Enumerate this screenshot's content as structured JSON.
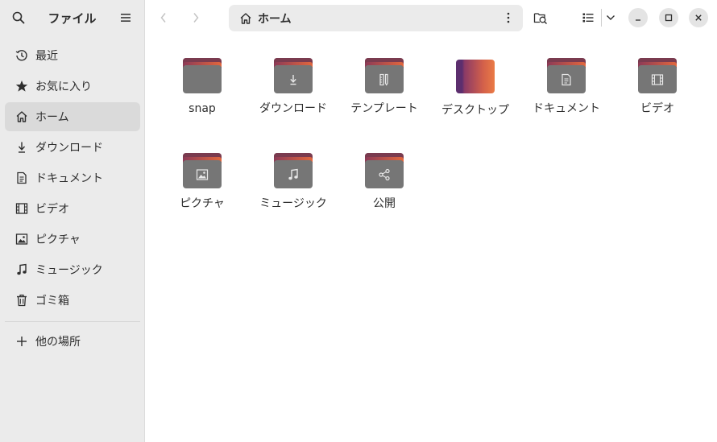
{
  "app": {
    "title": "ファイル"
  },
  "sidebar": {
    "items": [
      {
        "label": "最近",
        "icon": "clock-icon",
        "active": false
      },
      {
        "label": "お気に入り",
        "icon": "star-icon",
        "active": false
      },
      {
        "label": "ホーム",
        "icon": "home-icon",
        "active": true
      },
      {
        "label": "ダウンロード",
        "icon": "download-icon",
        "active": false
      },
      {
        "label": "ドキュメント",
        "icon": "document-icon",
        "active": false
      },
      {
        "label": "ビデオ",
        "icon": "film-icon",
        "active": false
      },
      {
        "label": "ピクチャ",
        "icon": "image-icon",
        "active": false
      },
      {
        "label": "ミュージック",
        "icon": "music-note-icon",
        "active": false
      },
      {
        "label": "ゴミ箱",
        "icon": "trash-icon",
        "active": false
      }
    ],
    "other_locations": {
      "label": "他の場所",
      "icon": "plus-icon"
    }
  },
  "pathbar": {
    "label": "ホーム",
    "icon": "home-icon"
  },
  "files": [
    {
      "label": "snap",
      "type": "folder",
      "icon": ""
    },
    {
      "label": "ダウンロード",
      "type": "folder",
      "icon": "download-icon"
    },
    {
      "label": "テンプレート",
      "type": "folder",
      "icon": "template-icon"
    },
    {
      "label": "デスクトップ",
      "type": "desktop",
      "icon": ""
    },
    {
      "label": "ドキュメント",
      "type": "folder",
      "icon": "document-icon"
    },
    {
      "label": "ビデオ",
      "type": "folder",
      "icon": "film-icon"
    },
    {
      "label": "ピクチャ",
      "type": "folder",
      "icon": "image-icon"
    },
    {
      "label": "ミュージック",
      "type": "folder",
      "icon": "music-note-icon"
    },
    {
      "label": "公開",
      "type": "folder",
      "icon": "share-icon"
    }
  ],
  "colors": {
    "sidebar_bg": "#ebebeb",
    "active_item_bg": "#dadada",
    "folder_body": "#767676",
    "folder_accent_start": "#8c3a57",
    "folder_accent_end": "#e2673d"
  }
}
